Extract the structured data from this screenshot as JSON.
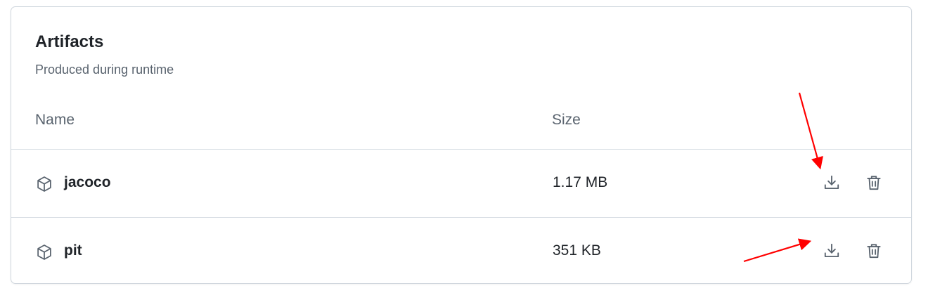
{
  "section": {
    "title": "Artifacts",
    "subtitle": "Produced during runtime"
  },
  "table": {
    "columns": [
      "Name",
      "Size"
    ],
    "rows": [
      {
        "name": "jacoco",
        "size": "1.17 MB",
        "icon": "package-icon"
      },
      {
        "name": "pit",
        "size": "351 KB",
        "icon": "package-icon"
      }
    ]
  },
  "actions": {
    "download_icon": "download-icon",
    "delete_icon": "trash-icon"
  },
  "colors": {
    "annotation_arrow": "#ff0000",
    "text_primary": "#1f2328",
    "text_muted": "#59636e",
    "border": "#d0d7de"
  }
}
